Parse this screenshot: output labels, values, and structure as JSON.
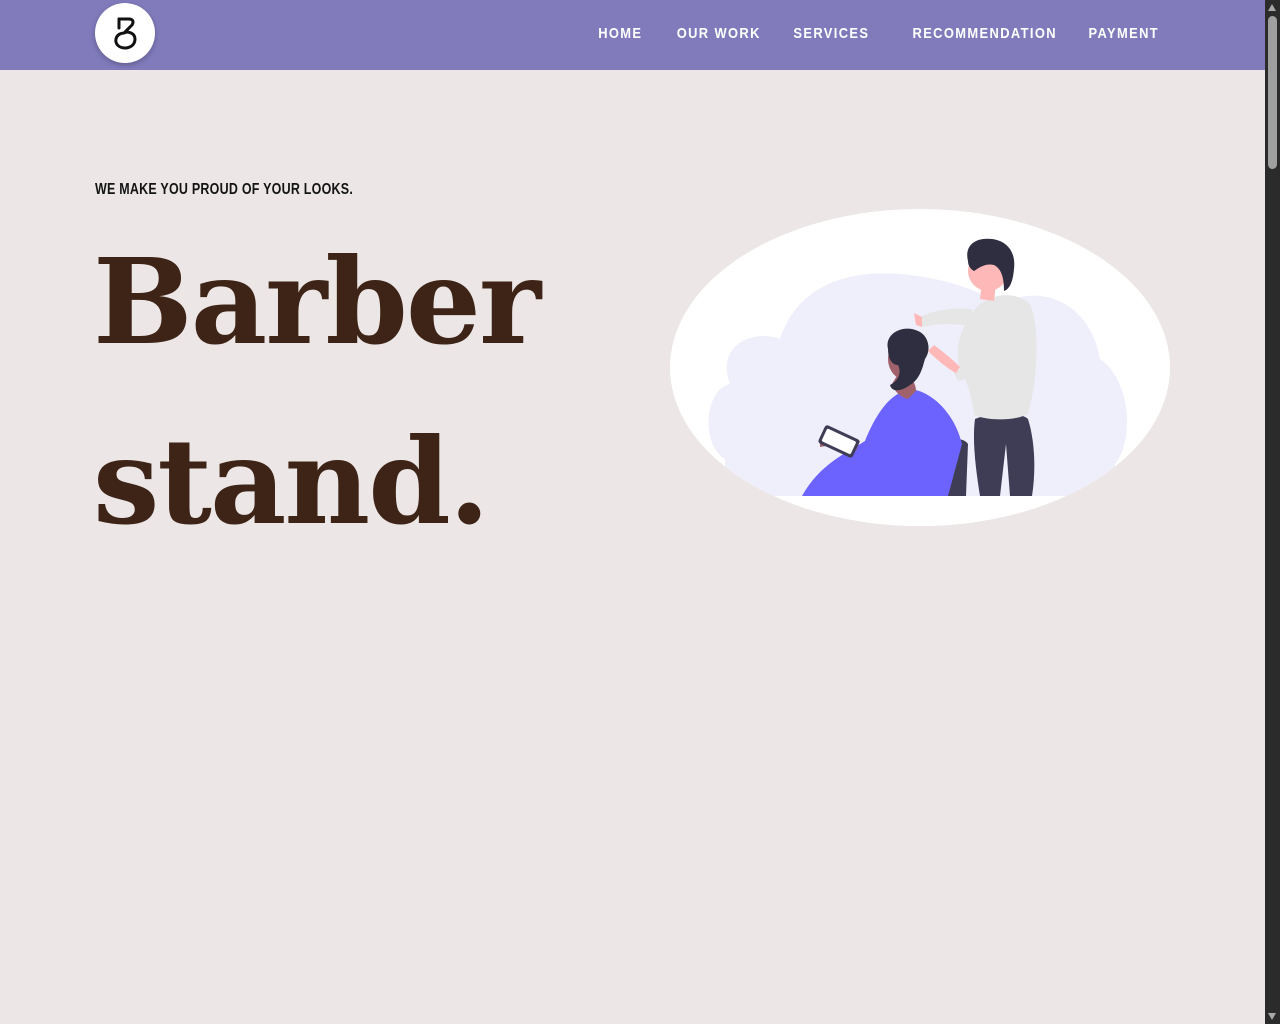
{
  "nav": {
    "logo_icon": "barber-stand-logo-icon",
    "links": [
      {
        "label": "HOME"
      },
      {
        "label": "OUR WORK"
      },
      {
        "label": "SERVICES"
      },
      {
        "label": "RECOMMENDATION"
      },
      {
        "label": "PAYMENT"
      }
    ]
  },
  "hero": {
    "tagline": "WE MAKE YOU PROUD OF YOUR LOOKS.",
    "title_line1": "Barber",
    "title_line2": "stand.",
    "illustration_icon": "barber-cutting-hair-illustration"
  },
  "colors": {
    "navbar": "#817bbc",
    "page_background": "#ece6e6",
    "title": "#3d2416",
    "accent_purple": "#6c63ff"
  }
}
